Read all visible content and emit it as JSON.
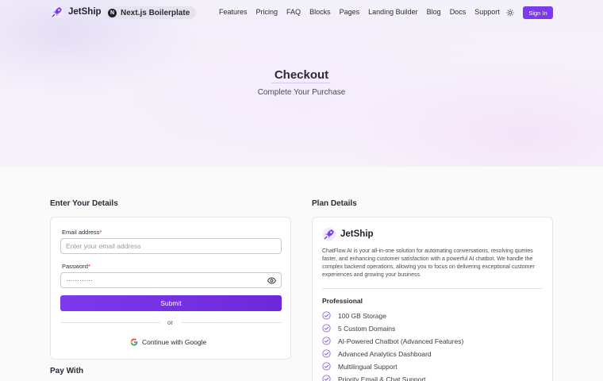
{
  "nav": {
    "logo_text": "JetShip",
    "pill_text": "Next.js Boilerplate",
    "pill_icon_letter": "N",
    "items": [
      "Features",
      "Pricing",
      "FAQ",
      "Blocks",
      "Pages",
      "Landing Builder",
      "Blog",
      "Docs",
      "Support"
    ],
    "signin_label": "Sign In",
    "theme_icon": "sun-icon"
  },
  "header": {
    "title": "Checkout",
    "subtitle": "Complete Your Purchase"
  },
  "details": {
    "section_title": "Enter Your Details",
    "email_label": "Email address",
    "email_placeholder": "Enter your email address",
    "password_label": "Password",
    "password_value": "············",
    "required_mark": "*",
    "submit_label": "Submit",
    "or_text": "or",
    "google_label": "Continue with Google"
  },
  "pay_with": {
    "section_title": "Pay With"
  },
  "plan": {
    "section_title": "Plan Details",
    "logo_text": "JetShip",
    "description": "ChatFlow AI is your all-in-one solution for automating conversations, resolving queries faster, and enhancing customer satisfaction with a powerful AI chatbot. We handle the complex backend operations, allowing you to focus on delivering exceptional customer experiences and growing your business.",
    "name": "Professional",
    "features": [
      "100 GB Storage",
      "5 Custom Domains",
      "AI-Powered Chatbot (Advanced Features)",
      "Advanced Analytics Dashboard",
      "Multilingual Support",
      "Priority Email & Chat Support"
    ]
  },
  "colors": {
    "accent": "#7c3aed",
    "required": "#dc2626",
    "check": "#8b5cf6"
  }
}
